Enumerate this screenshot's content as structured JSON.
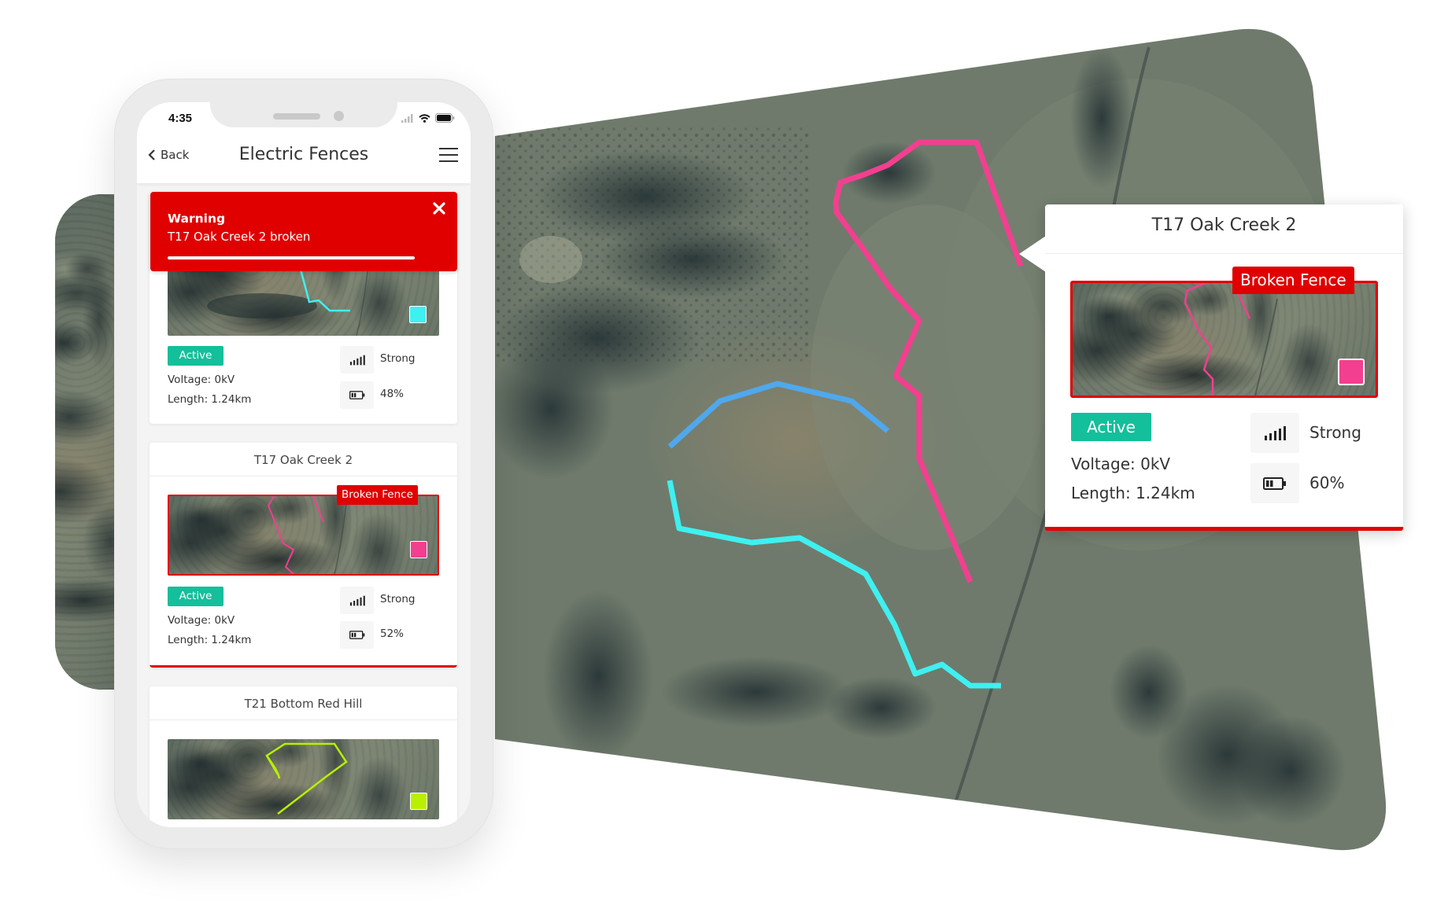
{
  "colors": {
    "alert_red": "#e00000",
    "active_green": "#14bf9b",
    "fence_pink": "#f23f8f",
    "fence_blue": "#4fa8ec",
    "fence_cyan": "#3ff0f0",
    "fence_lime": "#b8f000"
  },
  "status_bar": {
    "time": "4:35",
    "icons": [
      "cellular-signal-icon",
      "wifi-icon",
      "battery-icon"
    ]
  },
  "nav": {
    "back_label": "Back",
    "title": "Electric Fences",
    "menu_icon": "hamburger-menu-icon"
  },
  "warning": {
    "title": "Warning",
    "message": "T17 Oak Creek 2 broken",
    "close_icon": "close-icon",
    "progress": 0.91
  },
  "fences": [
    {
      "name": "",
      "status": "Active",
      "voltage": "Voltage: 0kV",
      "length": "Length: 1.24km",
      "signal": "Strong",
      "battery": "48%",
      "color": "#3ff0f0",
      "broken": false
    },
    {
      "name": "T17 Oak Creek 2",
      "status": "Active",
      "voltage": "Voltage: 0kV",
      "length": "Length: 1.24km",
      "signal": "Strong",
      "battery": "52%",
      "color": "#f23f8f",
      "broken": true,
      "broken_label": "Broken Fence"
    },
    {
      "name": "T21 Bottom Red Hill",
      "color": "#b8f000",
      "broken": false
    }
  ],
  "popup": {
    "title": "T17 Oak Creek 2",
    "broken_label": "Broken Fence",
    "status": "Active",
    "voltage": "Voltage: 0kV",
    "length": "Length: 1.24km",
    "signal": "Strong",
    "battery": "60%",
    "color": "#f23f8f"
  }
}
